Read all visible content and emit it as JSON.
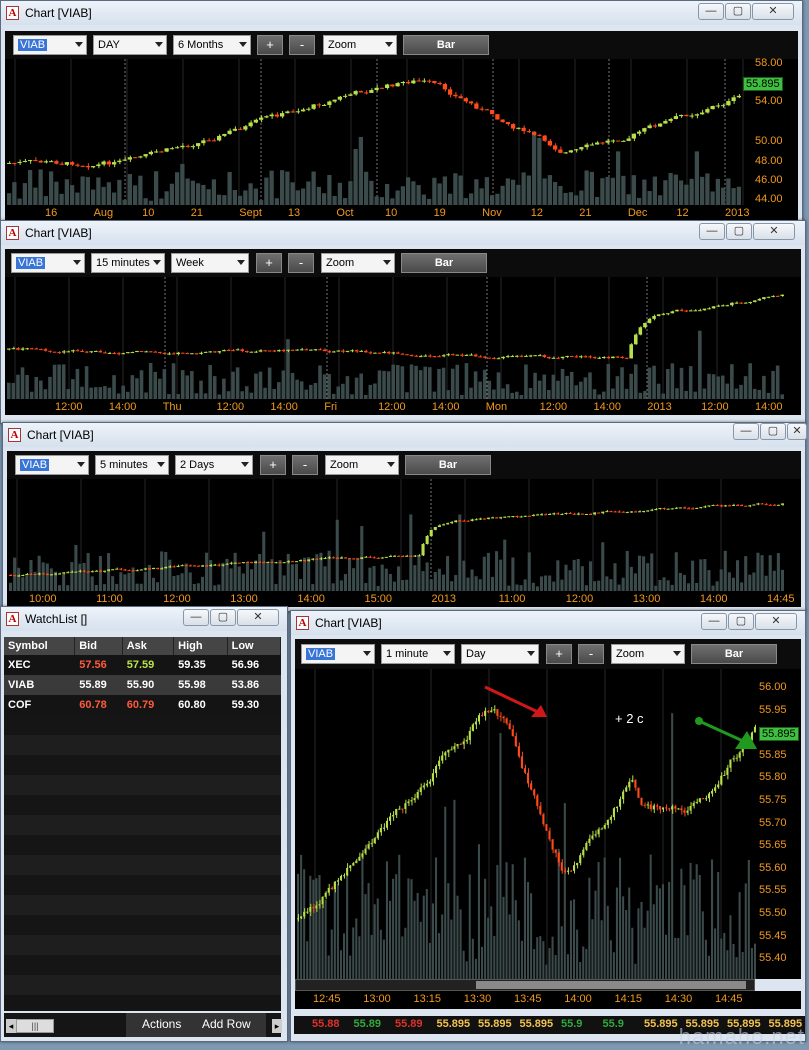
{
  "windows": {
    "chart1": {
      "title": "Chart [VIAB]",
      "symbol": "VIAB",
      "interval": "DAY",
      "range": "6 Months",
      "zoom_label": "Zoom",
      "style_label": "Bar",
      "plus": "+",
      "minus": "-",
      "x_labels": [
        "16",
        "Aug",
        "10",
        "21",
        "Sept",
        "13",
        "Oct",
        "10",
        "19",
        "Nov",
        "12",
        "21",
        "Dec",
        "12",
        "2013"
      ],
      "y_labels": [
        "58.00",
        "54.00",
        "50.00",
        "48.00",
        "46.00",
        "44.00"
      ],
      "last_price": "55.895"
    },
    "chart2": {
      "title": "Chart [VIAB]",
      "symbol": "VIAB",
      "interval": "15 minutes",
      "range": "Week",
      "zoom_label": "Zoom",
      "style_label": "Bar",
      "plus": "+",
      "minus": "-",
      "x_labels": [
        "12:00",
        "14:00",
        "Thu",
        "12:00",
        "14:00",
        "Fri",
        "12:00",
        "14:00",
        "Mon",
        "12:00",
        "14:00",
        "2013",
        "12:00",
        "14:00"
      ]
    },
    "chart3": {
      "title": "Chart [VIAB]",
      "symbol": "VIAB",
      "interval": "5 minutes",
      "range": "2 Days",
      "zoom_label": "Zoom",
      "style_label": "Bar",
      "plus": "+",
      "minus": "-",
      "x_labels": [
        "10:00",
        "11:00",
        "12:00",
        "13:00",
        "14:00",
        "15:00",
        "2013",
        "11:00",
        "12:00",
        "13:00",
        "14:00",
        "14:45"
      ]
    },
    "chart4": {
      "title": "Chart [VIAB]",
      "symbol": "VIAB",
      "interval": "1 minute",
      "range": "Day",
      "zoom_label": "Zoom",
      "style_label": "Bar",
      "plus": "+",
      "minus": "-",
      "x_labels": [
        "12:45",
        "13:00",
        "13:15",
        "13:30",
        "13:45",
        "14:00",
        "14:15",
        "14:30",
        "14:45"
      ],
      "y_labels": [
        "56.00",
        "55.95",
        "55.90",
        "55.85",
        "55.80",
        "55.75",
        "55.70",
        "55.65",
        "55.60",
        "55.55",
        "55.50",
        "55.45",
        "55.40"
      ],
      "last_price": "55.895",
      "annotation": "+ 2 c",
      "ticker": [
        {
          "v": "55.88",
          "c": "#e0312b"
        },
        {
          "v": "55.89",
          "c": "#2faa3c"
        },
        {
          "v": "55.89",
          "c": "#e0312b"
        },
        {
          "v": "55.895",
          "c": "#f2c14e"
        },
        {
          "v": "55.895",
          "c": "#f2c14e"
        },
        {
          "v": "55.895",
          "c": "#f2c14e"
        },
        {
          "v": "55.9",
          "c": "#2faa3c"
        },
        {
          "v": "55.9",
          "c": "#2faa3c"
        },
        {
          "v": "55.895",
          "c": "#f2c14e"
        },
        {
          "v": "55.895",
          "c": "#f2c14e"
        },
        {
          "v": "55.895",
          "c": "#f2c14e"
        },
        {
          "v": "55.895",
          "c": "#f2c14e"
        }
      ]
    },
    "watchlist": {
      "title": "WatchList []",
      "columns": [
        "Symbol",
        "Bid",
        "Ask",
        "High",
        "Low"
      ],
      "rows": [
        {
          "symbol": "XEC",
          "bid": "57.56",
          "ask": "57.59",
          "high": "59.35",
          "low": "56.96",
          "bid_color": "#ff5a3c",
          "ask_color": "#b9e34a"
        },
        {
          "symbol": "VIAB",
          "bid": "55.89",
          "ask": "55.90",
          "high": "55.98",
          "low": "53.86",
          "bid_color": "#ffffff",
          "ask_color": "#ffffff"
        },
        {
          "symbol": "COF",
          "bid": "60.78",
          "ask": "60.79",
          "high": "60.80",
          "low": "59.30",
          "bid_color": "#ff5a3c",
          "ask_color": "#ff5a3c"
        }
      ],
      "actions_label": "Actions",
      "add_row_label": "Add Row"
    }
  },
  "watermark": "hamaho.net"
}
